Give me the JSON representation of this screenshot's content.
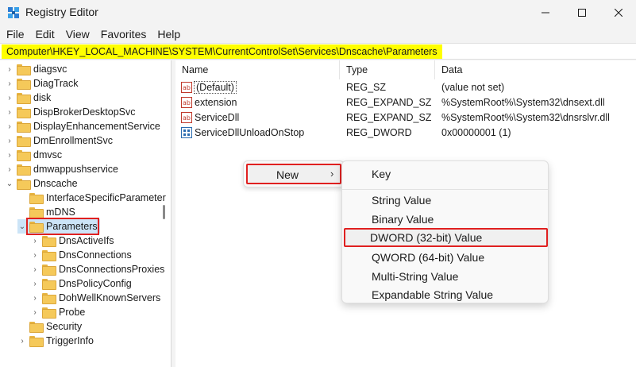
{
  "window": {
    "title": "Registry Editor"
  },
  "menu": [
    "File",
    "Edit",
    "View",
    "Favorites",
    "Help"
  ],
  "address": "Computer\\HKEY_LOCAL_MACHINE\\SYSTEM\\CurrentControlSet\\Services\\Dnscache\\Parameters",
  "tree": [
    {
      "label": "diagsvc",
      "chevron": "›"
    },
    {
      "label": "DiagTrack",
      "chevron": "›"
    },
    {
      "label": "disk",
      "chevron": "›"
    },
    {
      "label": "DispBrokerDesktopSvc",
      "chevron": "›"
    },
    {
      "label": "DisplayEnhancementService",
      "chevron": "›"
    },
    {
      "label": "DmEnrollmentSvc",
      "chevron": "›"
    },
    {
      "label": "dmvsc",
      "chevron": "›"
    },
    {
      "label": "dmwappushservice",
      "chevron": "›"
    },
    {
      "label": "Dnscache",
      "chevron": "⌄"
    },
    {
      "label": "InterfaceSpecificParameter",
      "chevron": ""
    },
    {
      "label": "mDNS",
      "chevron": ""
    },
    {
      "label": "Parameters",
      "chevron": "⌄"
    },
    {
      "label": "DnsActiveIfs",
      "chevron": "›"
    },
    {
      "label": "DnsConnections",
      "chevron": "›"
    },
    {
      "label": "DnsConnectionsProxies",
      "chevron": "›"
    },
    {
      "label": "DnsPolicyConfig",
      "chevron": "›"
    },
    {
      "label": "DohWellKnownServers",
      "chevron": "›"
    },
    {
      "label": "Probe",
      "chevron": "›"
    },
    {
      "label": "Security",
      "chevron": ""
    },
    {
      "label": "TriggerInfo",
      "chevron": "›"
    }
  ],
  "list": {
    "headers": {
      "name": "Name",
      "type": "Type",
      "data": "Data"
    },
    "rows": [
      {
        "name": "(Default)",
        "type": "REG_SZ",
        "data": "(value not set)",
        "icon": "string-value-icon"
      },
      {
        "name": "extension",
        "type": "REG_EXPAND_SZ",
        "data": "%SystemRoot%\\System32\\dnsext.dll",
        "icon": "string-value-icon"
      },
      {
        "name": "ServiceDll",
        "type": "REG_EXPAND_SZ",
        "data": "%SystemRoot%\\System32\\dnsrslvr.dll",
        "icon": "string-value-icon"
      },
      {
        "name": "ServiceDllUnloadOnStop",
        "type": "REG_DWORD",
        "data": "0x00000001 (1)",
        "icon": "binary-value-icon"
      }
    ]
  },
  "context_menu": {
    "new_label": "New",
    "new_arrow": "›"
  },
  "submenu": [
    "Key",
    "String Value",
    "Binary Value",
    "DWORD (32-bit) Value",
    "QWORD (64-bit) Value",
    "Multi-String Value",
    "Expandable String Value"
  ],
  "colors": {
    "highlight": "#e02020",
    "address_bg": "#ffff00",
    "selection": "#cce4f7"
  }
}
